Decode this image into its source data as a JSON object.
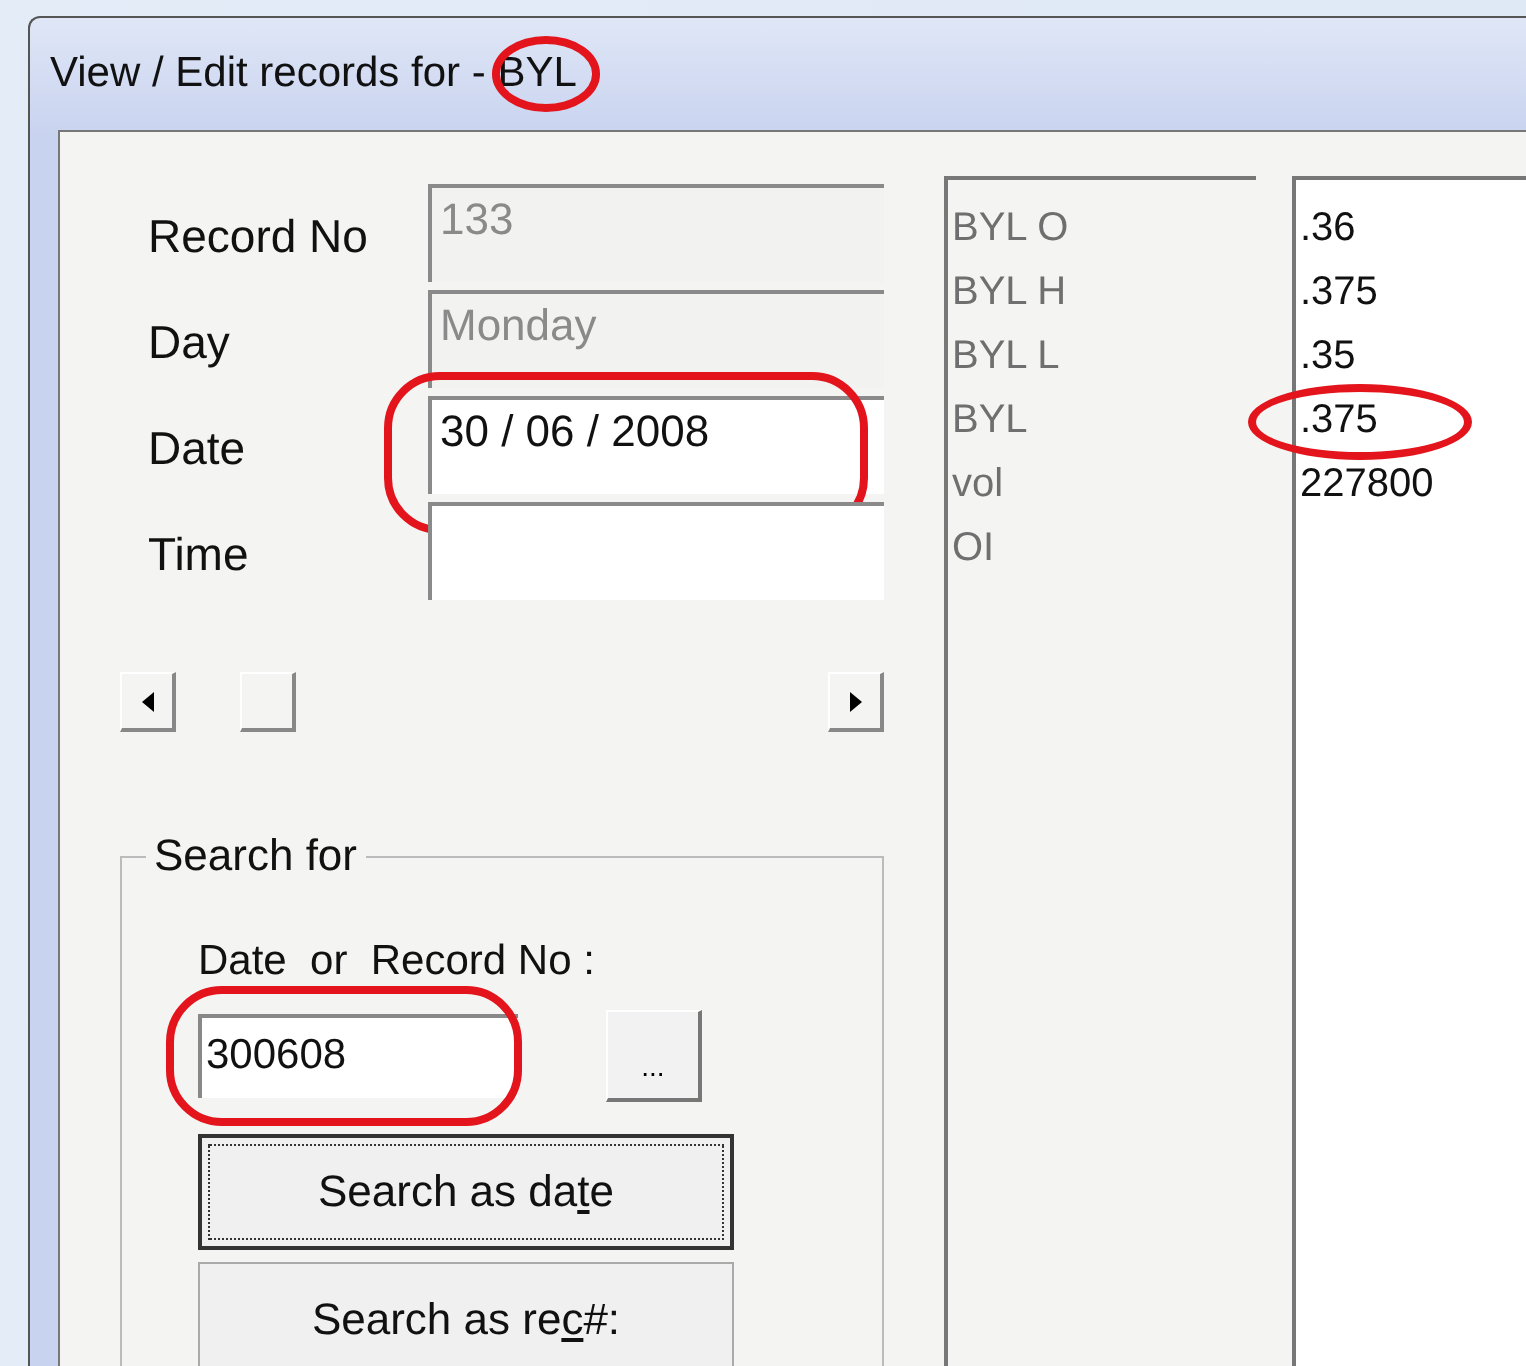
{
  "window": {
    "title": "View / Edit records for - ",
    "symbol": "BYL",
    "symbol_circled": true
  },
  "fields": [
    {
      "label": "Record No",
      "value": "133",
      "disabled": true,
      "circled": false
    },
    {
      "label": "Day",
      "value": "Monday",
      "disabled": true,
      "circled": false
    },
    {
      "label": "Date",
      "value": "30 / 06 / 2008",
      "disabled": false,
      "circled": true
    },
    {
      "label": "Time",
      "disabled": false,
      "circled": false
    }
  ],
  "search": {
    "title": "Search for",
    "label": "Date  or  Record No :",
    "value": "300608",
    "circled": true,
    "browse_button": "...",
    "buttons": [
      {
        "parts": [
          "Search as da",
          "t",
          "e"
        ],
        "focused": true
      },
      {
        "parts": [
          "Search as re",
          "c",
          "#:"
        ],
        "focused": false
      }
    ]
  },
  "records": [
    {
      "name": "BYL O",
      "value": ".36",
      "circled": false
    },
    {
      "name": "BYL H",
      "value": ".375",
      "circled": false
    },
    {
      "name": "BYL L",
      "value": ".35",
      "circled": false
    },
    {
      "name": "BYL",
      "value": ".375",
      "circled": true
    },
    {
      "name": "vol",
      "value": "227800",
      "circled": false
    },
    {
      "name": "OI",
      "circled": false
    }
  ]
}
